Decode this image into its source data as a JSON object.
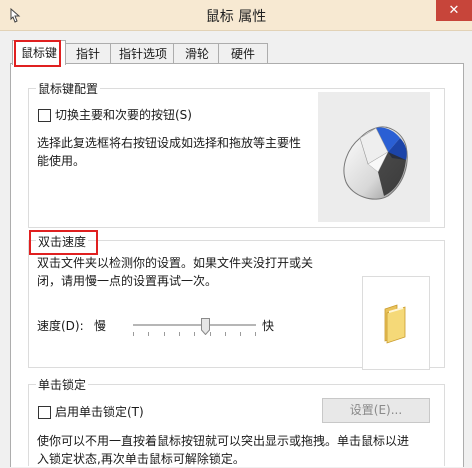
{
  "window": {
    "title": "鼠标 属性",
    "close_glyph": "✕",
    "icon": "mouse-pointer-icon"
  },
  "tabs": [
    {
      "label": "鼠标键",
      "active": true
    },
    {
      "label": "指针"
    },
    {
      "label": "指针选项"
    },
    {
      "label": "滑轮"
    },
    {
      "label": "硬件"
    }
  ],
  "button_config": {
    "group_title": "鼠标键配置",
    "swap_checkbox_label": "切换主要和次要的按钮(S)",
    "swap_checked": false,
    "description": "选择此复选框将右按钮设成如选择和拖放等主要性能使用。",
    "image": "mouse-illustration"
  },
  "double_click": {
    "group_title": "双击速度",
    "description_line1": "双击文件夹以检测你的设置。如果文件夹没打开或关",
    "description_line2": "闭，请用慢一点的设置再试一次。",
    "speed_label": "速度(D):",
    "slow_label": "慢",
    "fast_label": "快",
    "speed_value": 0.55,
    "image": "test-folder-icon"
  },
  "click_lock": {
    "group_title": "单击锁定",
    "enable_label": "启用单击锁定(T)",
    "enable_checked": false,
    "settings_button": "设置(E)...",
    "description_line1": "使你可以不用一直按着鼠标按钮就可以突出显示或拖拽。单击鼠标以进",
    "description_line2": "入锁定状态,再次单击鼠标可解除锁定。"
  },
  "colors": {
    "title_bar": "#f7e9d2",
    "close_button": "#c7453a",
    "highlight_frame": "#e02020",
    "mouse_accent": "#2a5fd4"
  }
}
